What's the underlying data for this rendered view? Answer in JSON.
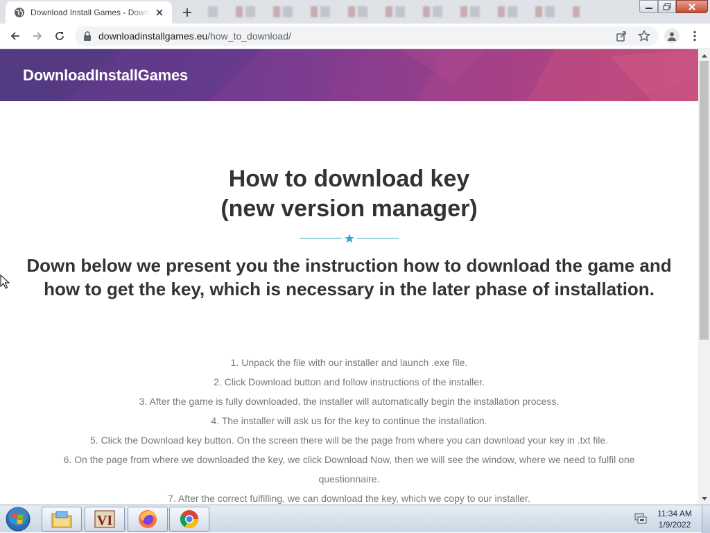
{
  "browser": {
    "tab": {
      "title": "Download Install Games - Download Install Games"
    },
    "address": {
      "domain": "downloadinstallgames.eu",
      "path": "/how_to_download/"
    }
  },
  "site": {
    "logo": "DownloadInstallGames",
    "title_line1": "How to download key",
    "title_line2": "(new version manager)",
    "subtitle_line1": "Down below we present you the instruction how to download the game and",
    "subtitle_line2": "how to get the key, which is necessary in the later phase of installation.",
    "steps": [
      "1. Unpack the file with our installer and launch .exe file.",
      "2. Click Download button and follow instructions of the installer.",
      "3. After the game is fully downloaded, the installer will automatically begin the installation process.",
      "4. The installer will ask us for the key to continue the installation.",
      "5. Click the Download key button. On the screen there will be the page from where you can download your key in .txt file.",
      "6. On the page from where we downloaded the key, we click Download Now, then we will see the window, where we need to fulfil one",
      "questionnaire.",
      "7. After the correct fulfilling, we can download the key, which we copy to our installer."
    ],
    "accent_color": "#3aa7c6"
  },
  "taskbar": {
    "apps": [
      "file-explorer",
      "vice-city",
      "firefox",
      "chrome"
    ],
    "clock_time": "11:34 AM",
    "clock_date": "1/9/2022"
  }
}
